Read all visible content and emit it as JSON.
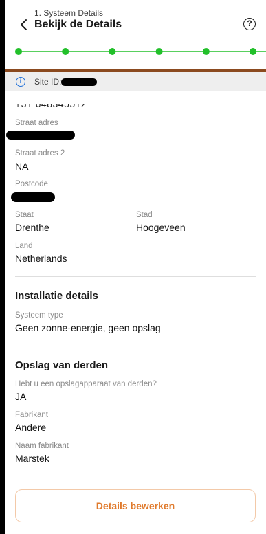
{
  "header": {
    "step_label": "1. Systeem Details",
    "title": "Bekijk de Details"
  },
  "stepper": {
    "total_steps": 6,
    "color": "#22c02a"
  },
  "site": {
    "label": "Site ID:"
  },
  "contact": {
    "phone_partial": "+31 648345512"
  },
  "address": {
    "street_label": "Straat adres",
    "street2_label": "Straat adres 2",
    "street2_value": "NA",
    "postcode_label": "Postcode",
    "state_label": "Staat",
    "state_value": "Drenthe",
    "city_label": "Stad",
    "city_value": "Hoogeveen",
    "country_label": "Land",
    "country_value": "Netherlands"
  },
  "installation": {
    "section_title": "Installatie details",
    "system_type_label": "Systeem type",
    "system_type_value": "Geen zonne-energie, geen opslag"
  },
  "third_party": {
    "section_title": "Opslag van derden",
    "question_label": "Hebt u een opslagapparaat van derden?",
    "question_value": "JA",
    "manufacturer_label": "Fabrikant",
    "manufacturer_value": "Andere",
    "manufacturer_name_label": "Naam fabrikant",
    "manufacturer_name_value": "Marstek"
  },
  "actions": {
    "edit_label": "Details bewerken"
  },
  "colors": {
    "accent": "#e07a2c",
    "brand_bar": "#8b4a1f",
    "info": "#1e6fd9"
  }
}
